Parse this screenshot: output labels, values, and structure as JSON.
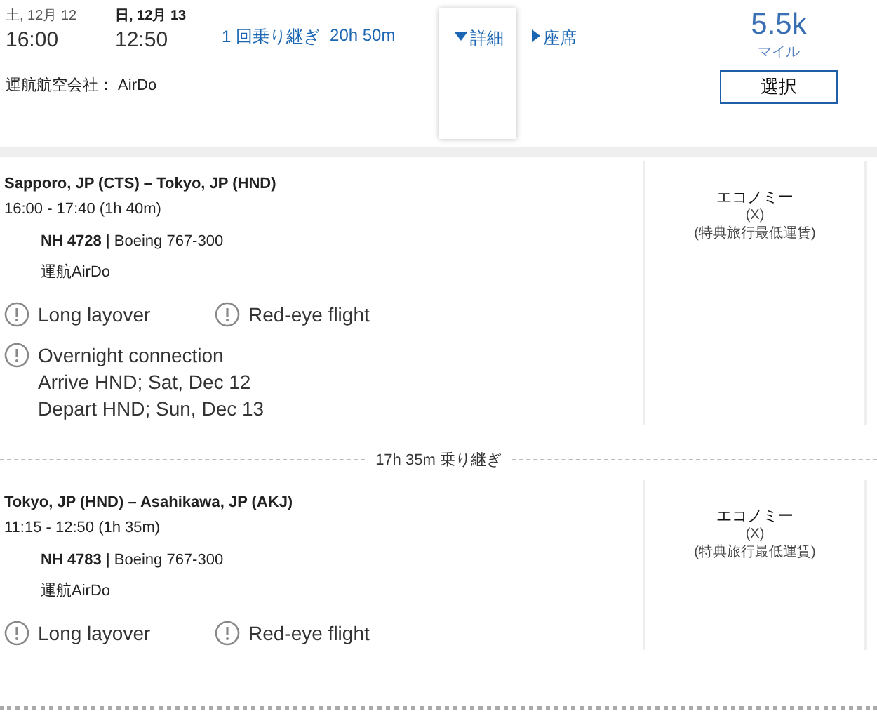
{
  "summary": {
    "depart_date": "土, 12月 12",
    "arrive_date": "日, 12月 13",
    "depart_time": "16:00",
    "arrive_time": "12:50",
    "stops": "1 回乗り継ぎ",
    "duration": "20h 50m",
    "operator": "運航航空会社： AirDo"
  },
  "tabs": [
    {
      "label": "詳細",
      "selected": true
    },
    {
      "label": "座席",
      "selected": false
    }
  ],
  "price": {
    "amount": "5.5k",
    "unit": "マイル",
    "button": "選択"
  },
  "segments": [
    {
      "route": "Sapporo, JP (CTS) – Tokyo, JP (HND)",
      "times": "16:00 - 17:40 (1h 40m)",
      "flight": "**NH 4728** | Boeing 767-300",
      "operated_by": "運航AirDo",
      "cabin": "エコノミー",
      "fare_code": "(X)",
      "fare_name": "(特典旅行最低運賃)",
      "warnings": [
        {
          "kind": "short",
          "text": "Long layover"
        },
        {
          "kind": "short",
          "text": "Red-eye flight"
        },
        {
          "kind": "detail",
          "text": "Overnight connection",
          "lines": [
            "Arrive HND; Sat, Dec 12",
            "Depart HND; Sun, Dec 13"
          ]
        }
      ]
    },
    {
      "route": "Tokyo, JP (HND) – Asahikawa, JP (AKJ)",
      "times": "11:15 - 12:50 (1h 35m)",
      "flight": "**NH 4783** | Boeing 767-300",
      "operated_by": "運航AirDo",
      "cabin": "エコノミー",
      "fare_code": "(X)",
      "fare_name": "(特典旅行最低運賃)",
      "warnings": [
        {
          "kind": "short",
          "text": "Long layover"
        },
        {
          "kind": "short",
          "text": "Red-eye flight"
        }
      ]
    }
  ],
  "connections": [
    "17h 35m 乗り継ぎ"
  ]
}
